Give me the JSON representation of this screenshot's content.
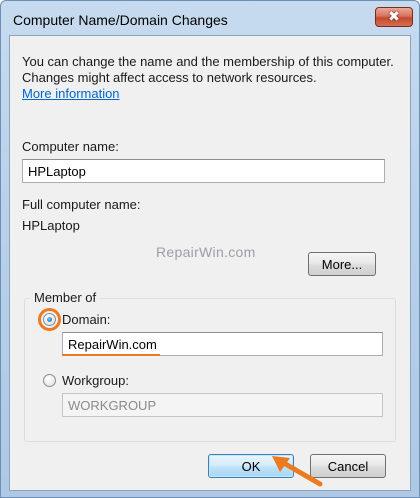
{
  "window": {
    "title": "Computer Name/Domain Changes",
    "close_glyph": "✖"
  },
  "description": "You can change the name and the membership of this computer. Changes might affect access to network resources.",
  "more_info_link": "More information",
  "computer_name": {
    "label": "Computer name:",
    "value": "HPLaptop"
  },
  "full_name": {
    "label": "Full computer name:",
    "value": "HPLaptop"
  },
  "watermark": "RepairWin.com",
  "more_button": "More...",
  "member_of": {
    "legend": "Member of",
    "domain": {
      "label": "Domain:",
      "value": "RepairWin.com",
      "selected": true
    },
    "workgroup": {
      "label": "Workgroup:",
      "value": "WORKGROUP",
      "selected": false
    }
  },
  "buttons": {
    "ok": "OK",
    "cancel": "Cancel"
  },
  "colors": {
    "highlight": "#ec7a21",
    "link": "#0066cc"
  },
  "icons": {
    "close": "close-icon",
    "arrow": "arrow-pointer-icon"
  }
}
